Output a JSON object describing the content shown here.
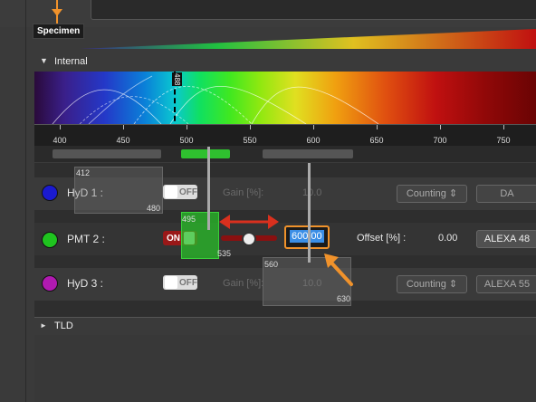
{
  "specimen": {
    "label": "Specimen"
  },
  "internal": {
    "label": "Internal",
    "chevron_icon": "triangle-down-icon"
  },
  "spectrum": {
    "laser_line": "488",
    "axis_ticks": [
      "400",
      "450",
      "500",
      "550",
      "600",
      "650",
      "700",
      "750"
    ]
  },
  "detectors": [
    {
      "name": "HyD 1 :",
      "color": "#1a1ad0",
      "toggle": "OFF",
      "gain_label": "Gain [%]:",
      "gain_value": "10.0",
      "mode": "Counting",
      "dye": "DA",
      "range_low": "412",
      "range_high": "480"
    },
    {
      "name": "PMT 2 :",
      "color": "#1fc41f",
      "toggle": "ON",
      "gain_value": "600.00",
      "offset_label": "Offset [%] :",
      "offset_value": "0.00",
      "dye": "ALEXA 48",
      "range_low": "495",
      "range_high": "535"
    },
    {
      "name": "HyD 3 :",
      "color": "#b01ab0",
      "toggle": "OFF",
      "gain_label": "Gain [%]:",
      "gain_value": "10.0",
      "mode": "Counting",
      "dye": "ALEXA 55",
      "range_low": "560",
      "range_high": "630"
    }
  ],
  "tld": {
    "label": "TLD",
    "chevron_icon": "triangle-right-icon"
  },
  "colors": {
    "accent_orange": "#f0922b",
    "arrow_red": "#d9301e",
    "highlight_blue": "#3a8ee6"
  }
}
